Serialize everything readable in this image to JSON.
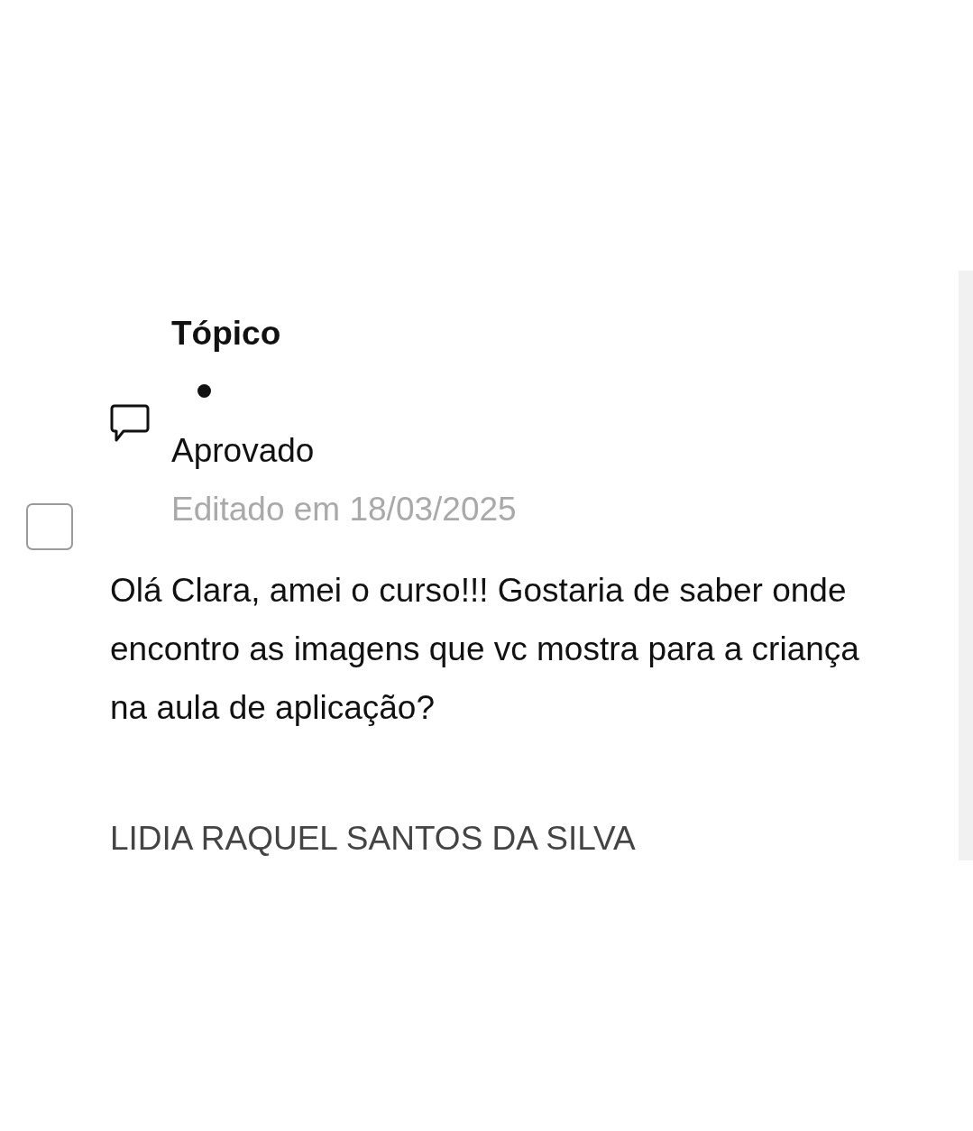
{
  "post": {
    "selected": false,
    "topic_label": "Tópico",
    "status": "Aprovado",
    "edited": "Editado em 18/03/2025",
    "message": "Olá Clara, amei o curso!!! Gostaria de saber onde encontro as imagens que vc mostra para a criança na aula de aplicação?",
    "author": "LIDIA RAQUEL SANTOS DA SILVA"
  }
}
